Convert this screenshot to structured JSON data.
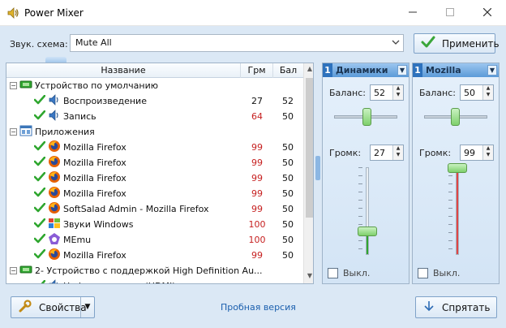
{
  "window": {
    "title": "Power Mixer",
    "controls": [
      "—",
      "☐",
      "✕"
    ]
  },
  "scheme": {
    "label": "Звук. схема:",
    "value": "Mute All"
  },
  "apply_label": "Применить",
  "tree": {
    "columns": [
      "Название",
      "Грм",
      "Бал"
    ],
    "rows": [
      {
        "name": "Устройство по умолчанию",
        "grm": "",
        "bal": "",
        "level": 0,
        "icon": "device-icon",
        "expander": true
      },
      {
        "name": "Воспроизведение",
        "grm": "27",
        "bal": "52",
        "level": 1,
        "icon": "speaker-icon",
        "grm_color": "dark"
      },
      {
        "name": "Запись",
        "grm": "64",
        "bal": "50",
        "level": 1,
        "icon": "speaker-icon",
        "grm_color": "red"
      },
      {
        "name": "Приложения",
        "grm": "",
        "bal": "",
        "level": 0,
        "icon": "apps-icon",
        "expander": true
      },
      {
        "name": "Mozilla Firefox",
        "grm": "99",
        "bal": "50",
        "level": 1,
        "icon": "firefox-icon",
        "grm_color": "red"
      },
      {
        "name": "Mozilla Firefox",
        "grm": "99",
        "bal": "50",
        "level": 1,
        "icon": "firefox-icon",
        "grm_color": "red"
      },
      {
        "name": "Mozilla Firefox",
        "grm": "99",
        "bal": "50",
        "level": 1,
        "icon": "firefox-icon",
        "grm_color": "red"
      },
      {
        "name": "Mozilla Firefox",
        "grm": "99",
        "bal": "50",
        "level": 1,
        "icon": "firefox-icon",
        "grm_color": "red"
      },
      {
        "name": "SoftSalad Admin - Mozilla Firefox",
        "grm": "99",
        "bal": "50",
        "level": 1,
        "icon": "firefox-icon",
        "grm_color": "red"
      },
      {
        "name": "Звуки Windows",
        "grm": "100",
        "bal": "50",
        "level": 1,
        "icon": "windows-icon",
        "grm_color": "red"
      },
      {
        "name": "MEmu",
        "grm": "100",
        "bal": "50",
        "level": 1,
        "icon": "memu-icon",
        "grm_color": "red"
      },
      {
        "name": "Mozilla Firefox",
        "grm": "99",
        "bal": "50",
        "level": 1,
        "icon": "firefox-icon",
        "grm_color": "red"
      },
      {
        "name": "2- Устройство с поддержкой High Definition Au...",
        "grm": "",
        "bal": "",
        "level": 0,
        "icon": "device-icon",
        "expander": true
      },
      {
        "name": "Цифровое аудио (HDMI)",
        "grm": "",
        "bal": "",
        "level": 1,
        "icon": "speaker-icon",
        "grm_color": "dark"
      }
    ]
  },
  "channels": [
    {
      "number": "1",
      "name": "Динамики",
      "balance_label": "Баланс:",
      "balance": "52",
      "balance_level": 52,
      "volume_label": "Громк:",
      "volume": "27",
      "volume_level": 27,
      "fill_color": "#2fa62f",
      "mute_label": "Выкл."
    },
    {
      "number": "1",
      "name": "Mozilla",
      "balance_label": "Баланс:",
      "balance": "50",
      "balance_level": 50,
      "volume_label": "Громк:",
      "volume": "99",
      "volume_level": 99,
      "fill_color": "#e04545",
      "mute_label": "Выкл."
    }
  ],
  "bottom": {
    "properties_label": "Свойства",
    "trial_text": "Пробная версия",
    "hide_label": "Спрятать"
  },
  "icons": {
    "app": "speaker-icon",
    "apply": "checkmark-icon",
    "properties": "wrench-icon",
    "hide": "arrow-down-icon"
  }
}
